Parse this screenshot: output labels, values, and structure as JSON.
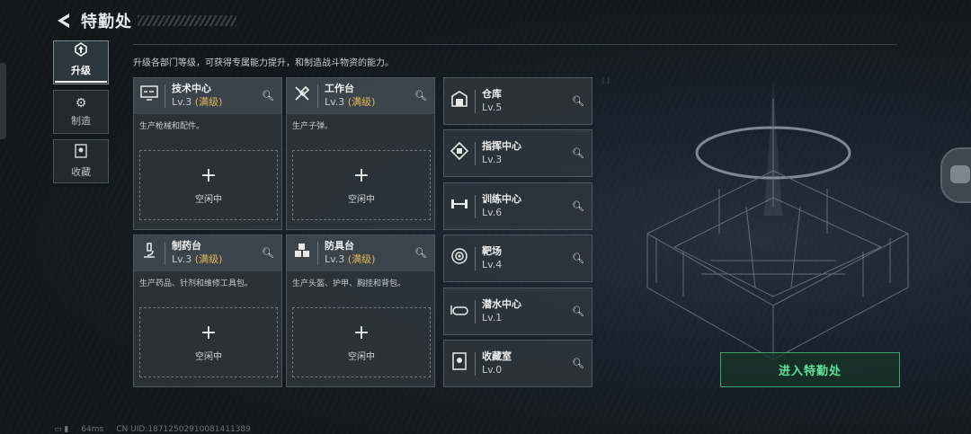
{
  "header": {
    "back_icon": "back-arrow-icon",
    "title": "特勤处"
  },
  "nav": [
    {
      "label": "升级",
      "icon": "upgrade-icon",
      "active": true
    },
    {
      "label": "制造",
      "icon": "gears-icon",
      "active": false
    },
    {
      "label": "收藏",
      "icon": "collection-icon",
      "active": false
    }
  ],
  "description": "升级各部门等级，可获得专属能力提升，和制造战斗物资的能力。",
  "workshops": [
    {
      "name": "技术中心",
      "level": "Lv.3",
      "max": "(满级)",
      "desc": "生产枪械和配件。",
      "icon": "monitor-icon",
      "slot_label": "空闲中"
    },
    {
      "name": "工作台",
      "level": "Lv.3",
      "max": "(满级)",
      "desc": "生产子弹。",
      "icon": "tools-icon",
      "slot_label": "空闲中"
    },
    {
      "name": "制药台",
      "level": "Lv.3",
      "max": "(满级)",
      "desc": "生产药品、针剂和维修工具包。",
      "icon": "microscope-icon",
      "slot_label": "空闲中"
    },
    {
      "name": "防具台",
      "level": "Lv.3",
      "max": "(满级)",
      "desc": "生产头盔、护甲、胸挂和背包。",
      "icon": "armor-boxes-icon",
      "slot_label": "空闲中"
    }
  ],
  "rooms": [
    {
      "name": "仓库",
      "level": "Lv.5",
      "icon": "warehouse-icon"
    },
    {
      "name": "指挥中心",
      "level": "Lv.3",
      "icon": "command-icon"
    },
    {
      "name": "训练中心",
      "level": "Lv.6",
      "icon": "dumbbell-icon"
    },
    {
      "name": "靶场",
      "level": "Lv.4",
      "icon": "target-icon"
    },
    {
      "name": "潜水中心",
      "level": "Lv.1",
      "icon": "diving-mask-icon"
    },
    {
      "name": "收藏室",
      "level": "Lv.0",
      "icon": "display-case-icon"
    }
  ],
  "enter_label": "进入特勤处",
  "status": {
    "ping": "64ms",
    "uid": "CN UID:187125029100814113​89"
  }
}
